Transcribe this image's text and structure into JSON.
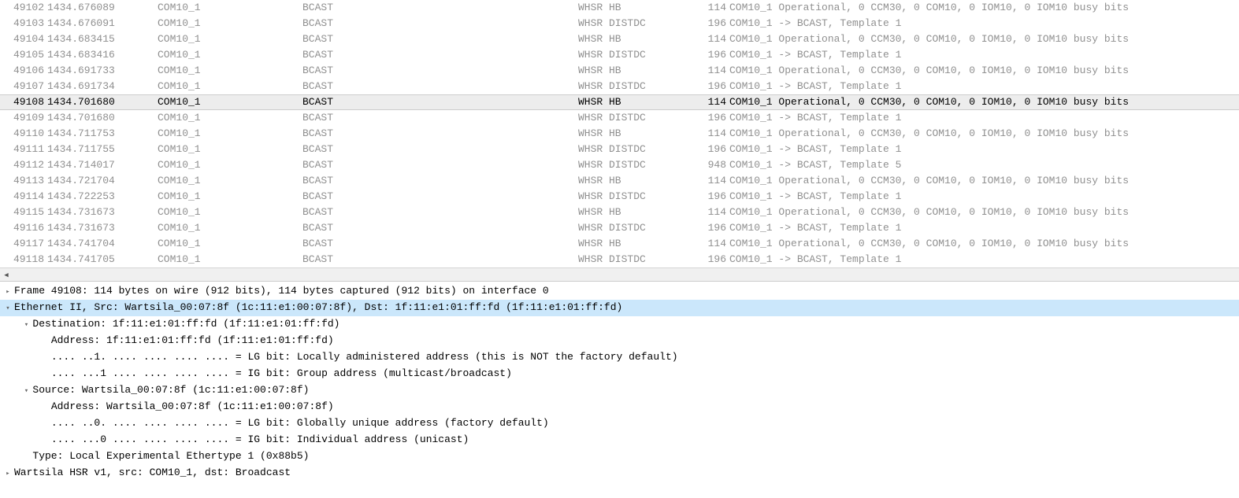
{
  "packets": [
    {
      "no": "49102",
      "time": "1434.676089",
      "src": "COM10_1",
      "dst": "BCAST",
      "proto": "WHSR HB",
      "len": "114",
      "info": "COM10_1 Operational, 0 CCM30, 0 COM10, 0 IOM10, 0 IOM10 busy bits",
      "sel": false
    },
    {
      "no": "49103",
      "time": "1434.676091",
      "src": "COM10_1",
      "dst": "BCAST",
      "proto": "WHSR DISTDC",
      "len": "196",
      "info": "COM10_1 -> BCAST, Template 1",
      "sel": false
    },
    {
      "no": "49104",
      "time": "1434.683415",
      "src": "COM10_1",
      "dst": "BCAST",
      "proto": "WHSR HB",
      "len": "114",
      "info": "COM10_1 Operational, 0 CCM30, 0 COM10, 0 IOM10, 0 IOM10 busy bits",
      "sel": false
    },
    {
      "no": "49105",
      "time": "1434.683416",
      "src": "COM10_1",
      "dst": "BCAST",
      "proto": "WHSR DISTDC",
      "len": "196",
      "info": "COM10_1 -> BCAST, Template 1",
      "sel": false
    },
    {
      "no": "49106",
      "time": "1434.691733",
      "src": "COM10_1",
      "dst": "BCAST",
      "proto": "WHSR HB",
      "len": "114",
      "info": "COM10_1 Operational, 0 CCM30, 0 COM10, 0 IOM10, 0 IOM10 busy bits",
      "sel": false
    },
    {
      "no": "49107",
      "time": "1434.691734",
      "src": "COM10_1",
      "dst": "BCAST",
      "proto": "WHSR DISTDC",
      "len": "196",
      "info": "COM10_1 -> BCAST, Template 1",
      "sel": false
    },
    {
      "no": "49108",
      "time": "1434.701680",
      "src": "COM10_1",
      "dst": "BCAST",
      "proto": "WHSR HB",
      "len": "114",
      "info": "COM10_1 Operational, 0 CCM30, 0 COM10, 0 IOM10, 0 IOM10 busy bits",
      "sel": true
    },
    {
      "no": "49109",
      "time": "1434.701680",
      "src": "COM10_1",
      "dst": "BCAST",
      "proto": "WHSR DISTDC",
      "len": "196",
      "info": "COM10_1 -> BCAST, Template 1",
      "sel": false
    },
    {
      "no": "49110",
      "time": "1434.711753",
      "src": "COM10_1",
      "dst": "BCAST",
      "proto": "WHSR HB",
      "len": "114",
      "info": "COM10_1 Operational, 0 CCM30, 0 COM10, 0 IOM10, 0 IOM10 busy bits",
      "sel": false
    },
    {
      "no": "49111",
      "time": "1434.711755",
      "src": "COM10_1",
      "dst": "BCAST",
      "proto": "WHSR DISTDC",
      "len": "196",
      "info": "COM10_1 -> BCAST, Template 1",
      "sel": false
    },
    {
      "no": "49112",
      "time": "1434.714017",
      "src": "COM10_1",
      "dst": "BCAST",
      "proto": "WHSR DISTDC",
      "len": "948",
      "info": "COM10_1 -> BCAST, Template 5",
      "sel": false
    },
    {
      "no": "49113",
      "time": "1434.721704",
      "src": "COM10_1",
      "dst": "BCAST",
      "proto": "WHSR HB",
      "len": "114",
      "info": "COM10_1 Operational, 0 CCM30, 0 COM10, 0 IOM10, 0 IOM10 busy bits",
      "sel": false
    },
    {
      "no": "49114",
      "time": "1434.722253",
      "src": "COM10_1",
      "dst": "BCAST",
      "proto": "WHSR DISTDC",
      "len": "196",
      "info": "COM10_1 -> BCAST, Template 1",
      "sel": false
    },
    {
      "no": "49115",
      "time": "1434.731673",
      "src": "COM10_1",
      "dst": "BCAST",
      "proto": "WHSR HB",
      "len": "114",
      "info": "COM10_1 Operational, 0 CCM30, 0 COM10, 0 IOM10, 0 IOM10 busy bits",
      "sel": false
    },
    {
      "no": "49116",
      "time": "1434.731673",
      "src": "COM10_1",
      "dst": "BCAST",
      "proto": "WHSR DISTDC",
      "len": "196",
      "info": "COM10_1 -> BCAST, Template 1",
      "sel": false
    },
    {
      "no": "49117",
      "time": "1434.741704",
      "src": "COM10_1",
      "dst": "BCAST",
      "proto": "WHSR HB",
      "len": "114",
      "info": "COM10_1 Operational, 0 CCM30, 0 COM10, 0 IOM10, 0 IOM10 busy bits",
      "sel": false
    },
    {
      "no": "49118",
      "time": "1434.741705",
      "src": "COM10_1",
      "dst": "BCAST",
      "proto": "WHSR DISTDC",
      "len": "196",
      "info": "COM10_1 -> BCAST, Template 1",
      "sel": false
    }
  ],
  "details": [
    {
      "indent": 0,
      "tw": ">",
      "text": "Frame 49108: 114 bytes on wire (912 bits), 114 bytes captured (912 bits) on interface 0",
      "sel": false
    },
    {
      "indent": 0,
      "tw": "v",
      "text": "Ethernet II, Src: Wartsila_00:07:8f (1c:11:e1:00:07:8f), Dst: 1f:11:e1:01:ff:fd (1f:11:e1:01:ff:fd)",
      "sel": true
    },
    {
      "indent": 1,
      "tw": "v",
      "text": "Destination: 1f:11:e1:01:ff:fd (1f:11:e1:01:ff:fd)",
      "sel": false
    },
    {
      "indent": 2,
      "tw": "",
      "text": "Address: 1f:11:e1:01:ff:fd (1f:11:e1:01:ff:fd)",
      "sel": false
    },
    {
      "indent": 2,
      "tw": "",
      "text": ".... ..1. .... .... .... .... = LG bit: Locally administered address (this is NOT the factory default)",
      "sel": false
    },
    {
      "indent": 2,
      "tw": "",
      "text": ".... ...1 .... .... .... .... = IG bit: Group address (multicast/broadcast)",
      "sel": false
    },
    {
      "indent": 1,
      "tw": "v",
      "text": "Source: Wartsila_00:07:8f (1c:11:e1:00:07:8f)",
      "sel": false
    },
    {
      "indent": 2,
      "tw": "",
      "text": "Address: Wartsila_00:07:8f (1c:11:e1:00:07:8f)",
      "sel": false
    },
    {
      "indent": 2,
      "tw": "",
      "text": ".... ..0. .... .... .... .... = LG bit: Globally unique address (factory default)",
      "sel": false
    },
    {
      "indent": 2,
      "tw": "",
      "text": ".... ...0 .... .... .... .... = IG bit: Individual address (unicast)",
      "sel": false
    },
    {
      "indent": 1,
      "tw": "",
      "text": "Type: Local Experimental Ethertype 1 (0x88b5)",
      "sel": false
    },
    {
      "indent": 0,
      "tw": ">",
      "text": "Wartsila HSR v1, src: COM10_1, dst: Broadcast",
      "sel": false
    }
  ],
  "scroll_left_glyph": "◀"
}
